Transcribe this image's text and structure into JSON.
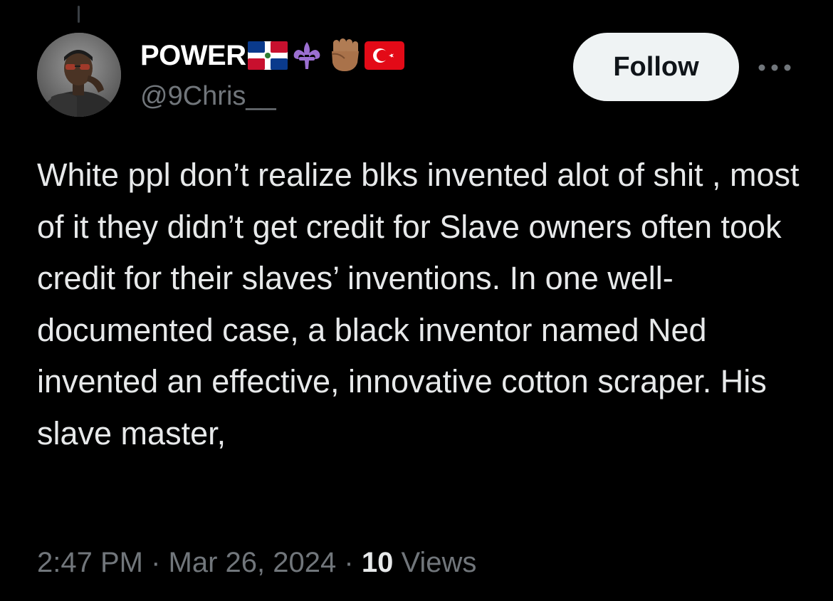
{
  "tweet": {
    "author": {
      "display_name": "POWER",
      "name_emojis": [
        "dominican-republic-flag-icon",
        "fleur-de-lis-icon",
        "raised-fist-icon",
        "turkey-flag-icon"
      ],
      "handle": "@9Chris__"
    },
    "follow_label": "Follow",
    "more_icon": "more-horizontal-icon",
    "text": "White ppl don’t realize blks invented alot of shit , most of it they didn’t get credit for Slave owners often took credit for their slaves’ inventions. In one well-documented case, a black inventor named Ned invented an effective, innovative cotton scraper. His slave master,",
    "time": "2:47 PM",
    "separator": "·",
    "date": "Mar 26, 2024",
    "views_count": "10",
    "views_label": "Views"
  },
  "colors": {
    "background": "#000000",
    "primary_text": "#e7e9ea",
    "secondary_text": "#71767b",
    "follow_button_bg": "#eff3f4",
    "follow_button_text": "#0f1419"
  }
}
